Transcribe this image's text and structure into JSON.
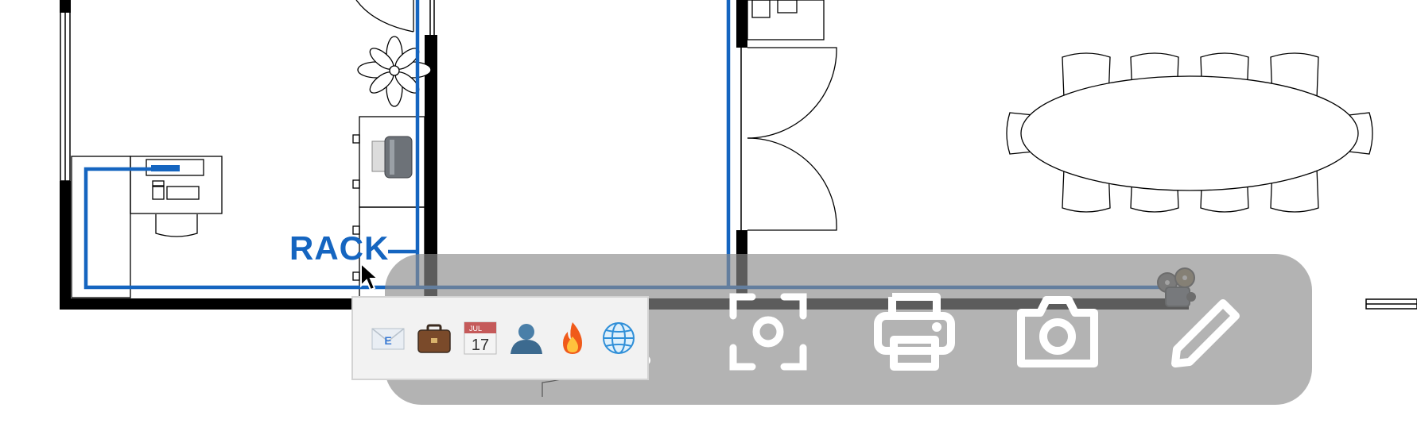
{
  "floorplan": {
    "rack_label": "RACK",
    "colors": {
      "wall": "#000000",
      "network_cable": "#1565c0",
      "furniture_line": "#222222"
    }
  },
  "overlay_toolbar": {
    "background": "#8c8c8c",
    "tools": [
      {
        "name": "search",
        "icon": "search-icon"
      },
      {
        "name": "screenshot",
        "icon": "screenshot-region-icon"
      },
      {
        "name": "print",
        "icon": "printer-icon"
      },
      {
        "name": "camera",
        "icon": "camera-icon"
      },
      {
        "name": "edit",
        "icon": "pencil-icon"
      }
    ]
  },
  "app_popup": {
    "apps": [
      {
        "name": "mail",
        "icon": "mail-envelope-icon",
        "glyph": "E"
      },
      {
        "name": "briefcase",
        "icon": "briefcase-icon"
      },
      {
        "name": "calendar",
        "icon": "calendar-icon",
        "month": "JUL",
        "day": "17"
      },
      {
        "name": "contacts",
        "icon": "person-icon"
      },
      {
        "name": "fire",
        "icon": "fire-icon"
      },
      {
        "name": "globe",
        "icon": "globe-icon"
      }
    ]
  }
}
